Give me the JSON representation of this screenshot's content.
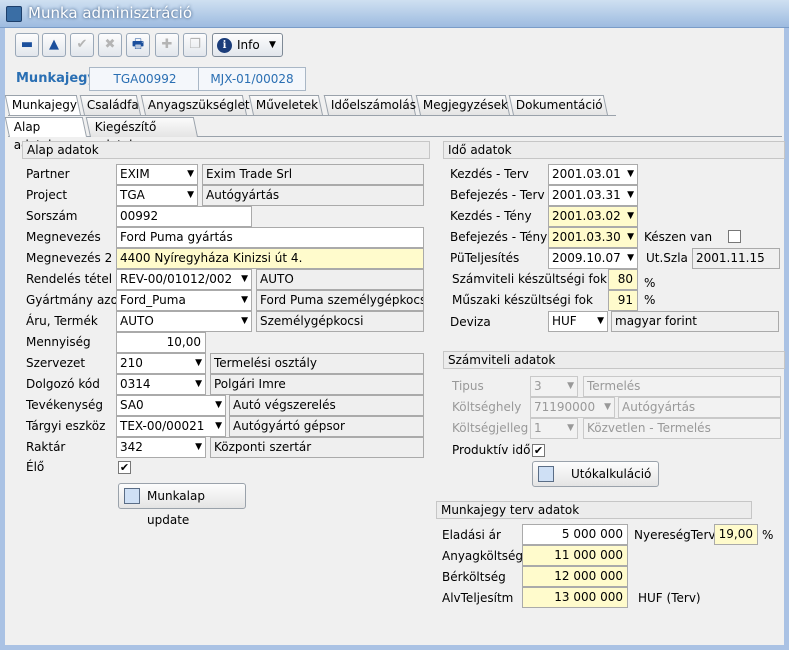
{
  "window": {
    "title": "Munka adminisztráció"
  },
  "toolbar": {
    "buttons": [
      {
        "name": "minus-icon",
        "glyph": "▬"
      },
      {
        "name": "up-arrow-icon",
        "glyph": "▲"
      },
      {
        "name": "checkmark-icon",
        "glyph": "✔"
      },
      {
        "name": "cancel-icon",
        "glyph": "✖"
      },
      {
        "name": "print-icon",
        "glyph": "🖶"
      },
      {
        "name": "add-icon",
        "glyph": "✚"
      },
      {
        "name": "copy-icon",
        "glyph": "❐"
      }
    ],
    "info_label": "Info"
  },
  "header": {
    "label": "Munkajegy",
    "code1": "TGA00992",
    "code2": "MJX-01/00028"
  },
  "tabs": [
    "Munkajegy",
    "Családfa",
    "Anyagszükséglet",
    "Műveletek",
    "Időelszámolás",
    "Megjegyzések",
    "Dokumentáció"
  ],
  "subtabs": [
    "Alap adatok",
    "Kiegészítő adatok"
  ],
  "alap": {
    "title": "Alap adatok",
    "partner": {
      "label": "Partner",
      "value": "EXIM",
      "desc": "Exim Trade Srl"
    },
    "project": {
      "label": "Project",
      "value": "TGA",
      "desc": "Autógyártás"
    },
    "sorszam": {
      "label": "Sorszám",
      "value": "00992"
    },
    "megnevezes": {
      "label": "Megnevezés",
      "value": "Ford Puma gyártás"
    },
    "megnevezes2": {
      "label": "Megnevezés 2",
      "value": "4400 Nyíregyháza Kinizsi út 4."
    },
    "rendeles": {
      "label": "Rendelés tétel",
      "value": "REV-00/01012/002",
      "desc": "AUTO"
    },
    "gyartmany": {
      "label": "Gyártmány azon",
      "value": "Ford_Puma",
      "desc": "Ford Puma személygépkocsi"
    },
    "aru": {
      "label": "Áru, Termék",
      "value": "AUTO",
      "desc": "Személygépkocsi"
    },
    "mennyiseg": {
      "label": "Mennyiség",
      "value": "10,00"
    },
    "szervezet": {
      "label": "Szervezet",
      "value": "210",
      "desc": "Termelési osztály"
    },
    "dolgozo": {
      "label": "Dolgozó kód",
      "value": "0314",
      "desc": "Polgári Imre"
    },
    "tevekenyseg": {
      "label": "Tevékenység",
      "value": "SA0",
      "desc": "Autó végszerelés"
    },
    "targyi": {
      "label": "Tárgyi eszköz",
      "value": "TEX-00/00021",
      "desc": "Autógyártó gépsor"
    },
    "raktar": {
      "label": "Raktár",
      "value": "342",
      "desc": "Központi szertár"
    },
    "elo": {
      "label": "Élő",
      "checked": "✔"
    },
    "update_button": "Munkalap update"
  },
  "ido": {
    "title": "Idő adatok",
    "kezdes_terv": {
      "label": "Kezdés - Terv",
      "value": "2001.03.01"
    },
    "befejezes_terv": {
      "label": "Befejezés - Terv",
      "value": "2001.03.31"
    },
    "kezdes_teny": {
      "label": "Kezdés - Tény",
      "value": "2001.03.02"
    },
    "befejezes_teny": {
      "label": "Befejezés - Tény",
      "value": "2001.03.30"
    },
    "kesz": {
      "label": "Készen van"
    },
    "putelj": {
      "label": "PüTeljesítés",
      "value": "2009.10.07"
    },
    "utszla": {
      "label": "Ut.Szla",
      "value": "2001.11.15"
    },
    "szamviteli_fok": {
      "label": "Számviteli készültségi fok",
      "value": "80",
      "unit": "%"
    },
    "muszaki_fok": {
      "label": "Műszaki készültségi fok",
      "value": "91",
      "unit": "%"
    },
    "deviza": {
      "label": "Deviza",
      "value": "HUF",
      "desc": "magyar forint"
    }
  },
  "szamviteli": {
    "title": "Számviteli adatok",
    "tipus": {
      "label": "Tipus",
      "value": "3",
      "desc": "Termelés"
    },
    "koltseghely": {
      "label": "Költséghely",
      "value": "71190000",
      "desc": "Autógyártás"
    },
    "koltsegjelleg": {
      "label": "Költségjelleg",
      "value": "1",
      "desc": "Közvetlen - Termelés"
    },
    "produktiv": {
      "label": "Produktív idő",
      "checked": "✔"
    },
    "utokalk_button": "Utókalkuláció"
  },
  "terv": {
    "title": "Munkajegy terv adatok",
    "eladasi": {
      "label": "Eladási ár",
      "value": "5 000 000"
    },
    "nyereseg": {
      "label": "NyereségTerv",
      "value": "19,00",
      "unit": "%"
    },
    "anyag": {
      "label": "Anyagköltség",
      "value": "11 000 000"
    },
    "ber": {
      "label": "Bérköltség",
      "value": "12 000 000"
    },
    "alv": {
      "label": "AlvTeljesítm",
      "value": "13 000 000"
    },
    "currency": "HUF  (Terv)"
  }
}
